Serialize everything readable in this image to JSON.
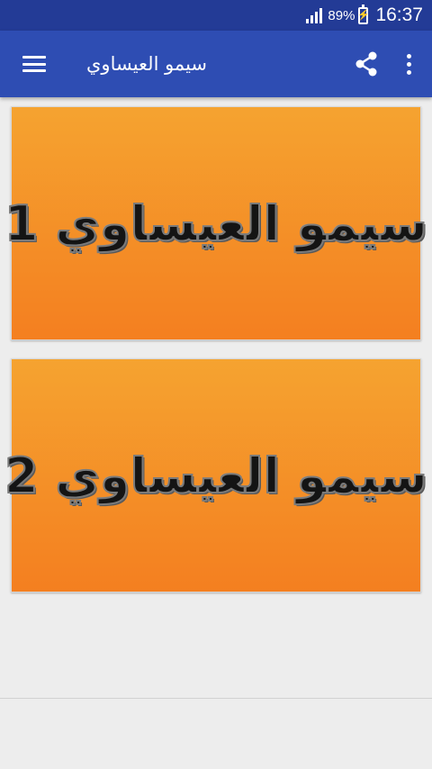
{
  "status_bar": {
    "battery_percent": "89%",
    "time": "16:37",
    "icons": [
      "signal-icon",
      "battery-charging-icon"
    ]
  },
  "app_bar": {
    "title": "سيمو العيساوي",
    "icons": [
      "menu-icon",
      "share-icon",
      "more-vert-icon"
    ],
    "color": "#2e4db3"
  },
  "status_bar_color": "#233b96",
  "cards": [
    {
      "label": "سيمو العيساوي 1"
    },
    {
      "label": "سيمو العيساوي 2"
    }
  ],
  "card_colors": {
    "top": "#f5a330",
    "bottom": "#f47f20"
  }
}
